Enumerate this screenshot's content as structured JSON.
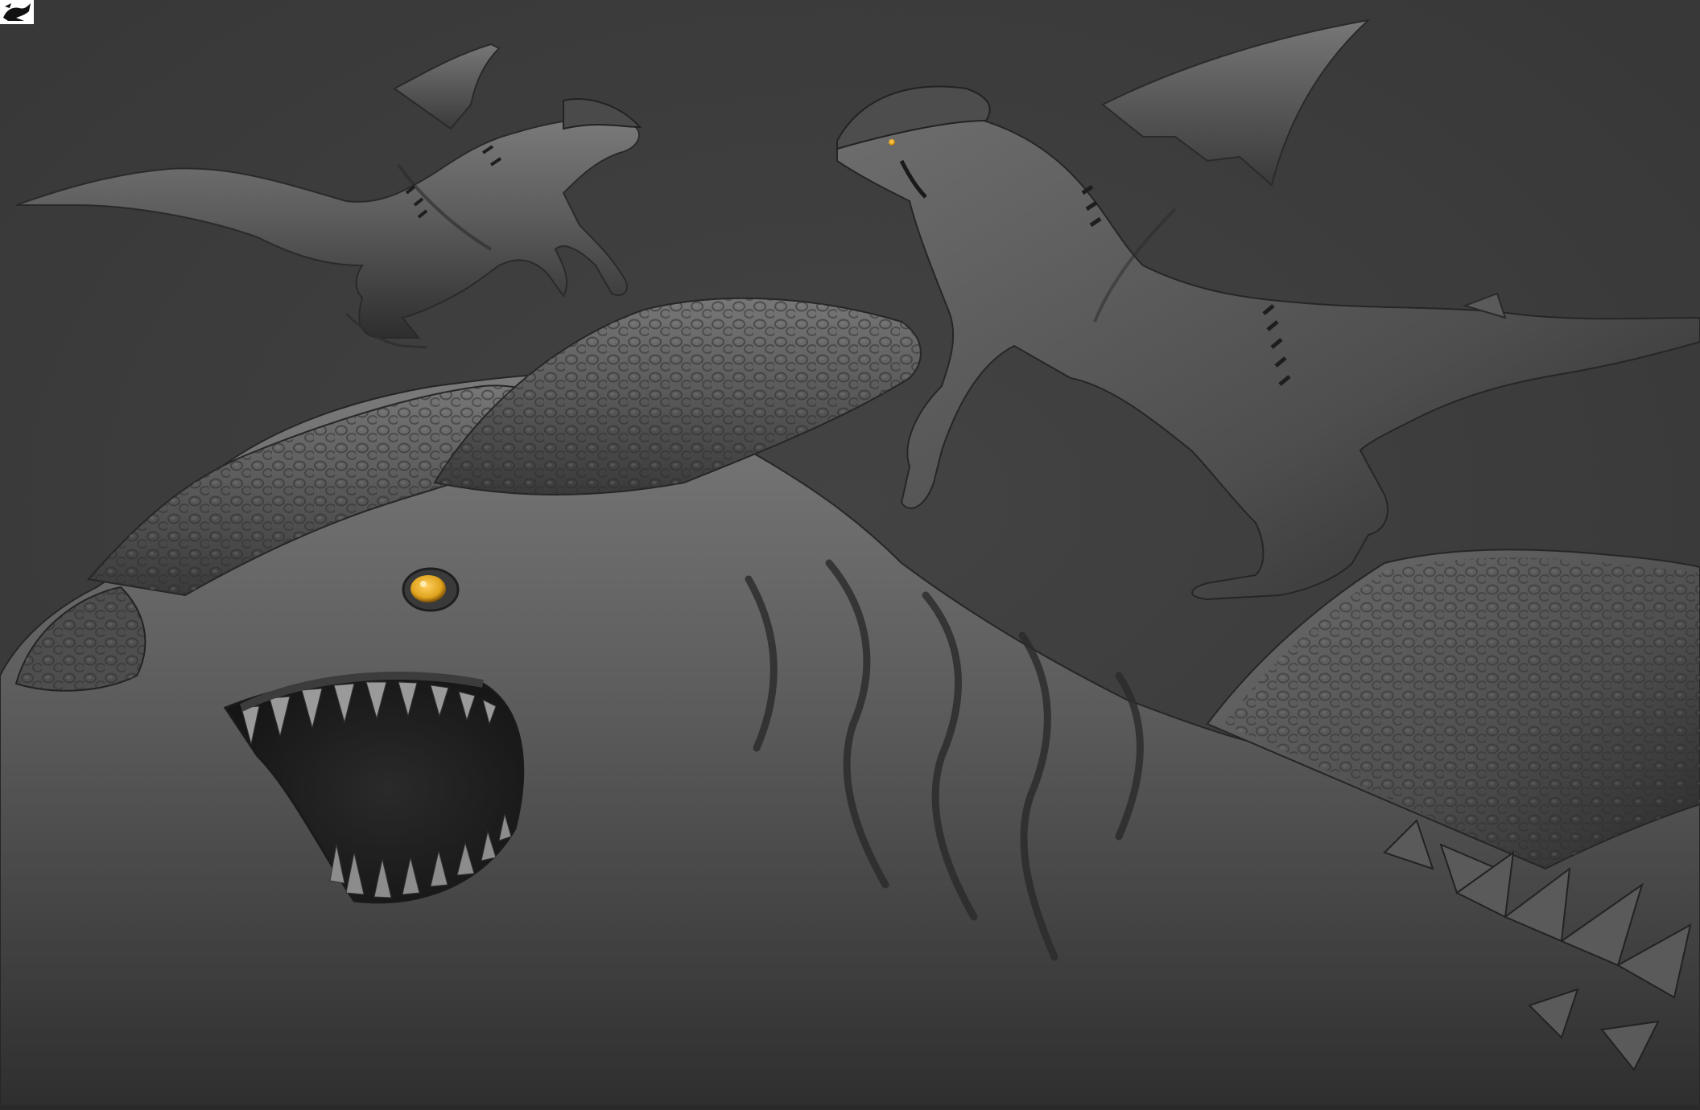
{
  "viewport": {
    "background": "#3c3c3c",
    "material_base": "#5a5a5a",
    "material_shadow": "#262626",
    "material_highlight": "#8a8a8a",
    "eye_color": "#e0a41e",
    "logo_icon": "zbrush-logo-icon"
  },
  "models": [
    {
      "view": "hero-closeup"
    },
    {
      "view": "full-body-side-left"
    },
    {
      "view": "full-body-side-right"
    }
  ]
}
